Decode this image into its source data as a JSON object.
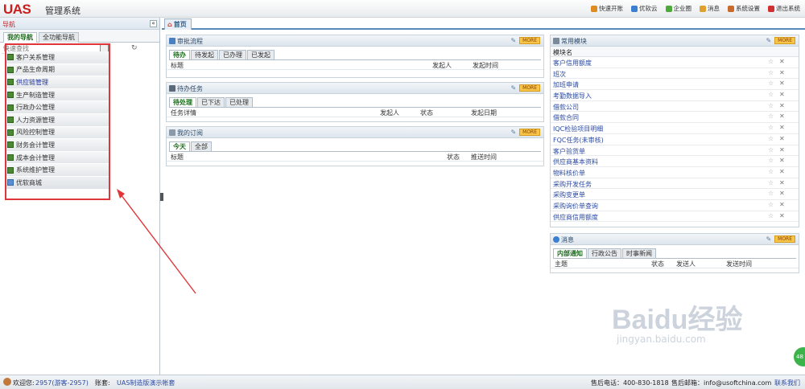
{
  "header": {
    "logo": "UAS",
    "title": "管理系统",
    "menu": [
      {
        "label": "快速开账",
        "icon": "quick-icon",
        "color": "#e08a22"
      },
      {
        "label": "优软云",
        "icon": "cloud-icon",
        "color": "#3a7fd0"
      },
      {
        "label": "企业圈",
        "icon": "circle-icon",
        "color": "#4caa3a"
      },
      {
        "label": "消息",
        "icon": "message-icon",
        "color": "#e0a030"
      },
      {
        "label": "系统设置",
        "icon": "tools-icon",
        "color": "#c86a2a"
      },
      {
        "label": "退出系统",
        "icon": "power-icon",
        "color": "#d03030"
      }
    ]
  },
  "nav": {
    "title": "导航",
    "collapse": "«",
    "tabs": [
      "我的导航",
      "全功能导航"
    ],
    "search_placeholder": "快速查找",
    "modules": [
      {
        "label": "客户关系管理",
        "style": "grey"
      },
      {
        "label": "产品生命周期",
        "style": "grey"
      },
      {
        "label": "供应链管理",
        "style": "blue"
      },
      {
        "label": "生产制造管理",
        "style": "grey"
      },
      {
        "label": "行政办公管理",
        "style": "grey"
      },
      {
        "label": "人力资源管理",
        "style": "grey"
      },
      {
        "label": "风险控制管理",
        "style": "grey"
      },
      {
        "label": "财务会计管理",
        "style": "grey"
      },
      {
        "label": "成本会计管理",
        "style": "grey"
      },
      {
        "label": "系统维护管理",
        "style": "grey"
      },
      {
        "label": "优软商城",
        "style": "mall"
      }
    ]
  },
  "home_tab": "首页",
  "approval": {
    "title": "审批流程",
    "more": "MORE",
    "tabs": [
      "待办",
      "待发起",
      "已办理",
      "已发起"
    ],
    "cols": [
      "标题",
      "发起人",
      "发起时间"
    ]
  },
  "tasks": {
    "title": "待办任务",
    "more": "MORE",
    "tabs": [
      "待处理",
      "已下达",
      "已处理"
    ],
    "cols": [
      "任务详情",
      "发起人",
      "状态",
      "发起日期"
    ]
  },
  "subscribe": {
    "title": "我的订阅",
    "more": "MORE",
    "tabs": [
      "今天",
      "全部"
    ],
    "cols": [
      "标题",
      "状态",
      "推送时间"
    ]
  },
  "common": {
    "title": "常用模块",
    "more": "MORE",
    "header": "模块名",
    "items": [
      "客户信用额度",
      "班次",
      "加班申请",
      "考勤数据导入",
      "借款公司",
      "借款合同",
      "IQC检验项目明细",
      "FQC任务(未审核)",
      "客户验货单",
      "供应商基本资料",
      "物料核价单",
      "采购开发任务",
      "采购变更单",
      "采购询价单查询",
      "供应商信用额度"
    ]
  },
  "messages": {
    "title": "消息",
    "more": "MORE",
    "tabs": [
      "内部通知",
      "行政公告",
      "时事新闻"
    ],
    "cols": [
      "主题",
      "状态",
      "发送人",
      "发送时间"
    ]
  },
  "status": {
    "welcome": "欢迎您:",
    "user": "2957(游客-2957)",
    "account_label": "账套:",
    "account": "UAS制造版演示帐套",
    "phone": "售后电话：400-830-1818",
    "email": "售后邮箱：info@usoftchina.com",
    "contact": "联系我们"
  },
  "watermark": {
    "text": "Baidu经验",
    "url": "jingyan.baidu.com"
  },
  "bubble": "48"
}
